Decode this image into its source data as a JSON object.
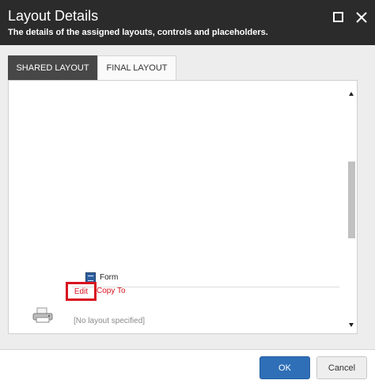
{
  "dialog": {
    "title": "Layout Details",
    "subtitle": "The details of the assigned layouts, controls and placeholders."
  },
  "tabs": [
    {
      "label": "SHARED LAYOUT",
      "active": true
    },
    {
      "label": "FINAL LAYOUT",
      "active": false
    }
  ],
  "content": {
    "rendering_label": "Form",
    "edit_label": "Edit",
    "copy_label": "Copy To",
    "no_layout_text": "[No layout specified]"
  },
  "buttons": {
    "ok_label": "OK",
    "cancel_label": "Cancel"
  },
  "icons": {
    "maximize": "maximize-icon",
    "close": "close-icon",
    "rendering": "form-icon",
    "device": "printer-icon"
  },
  "colors": {
    "titlebar": "#2b2b2b",
    "active_tab": "#474747",
    "accent_red": "#d8141f",
    "ok_blue": "#2f6fb8"
  }
}
